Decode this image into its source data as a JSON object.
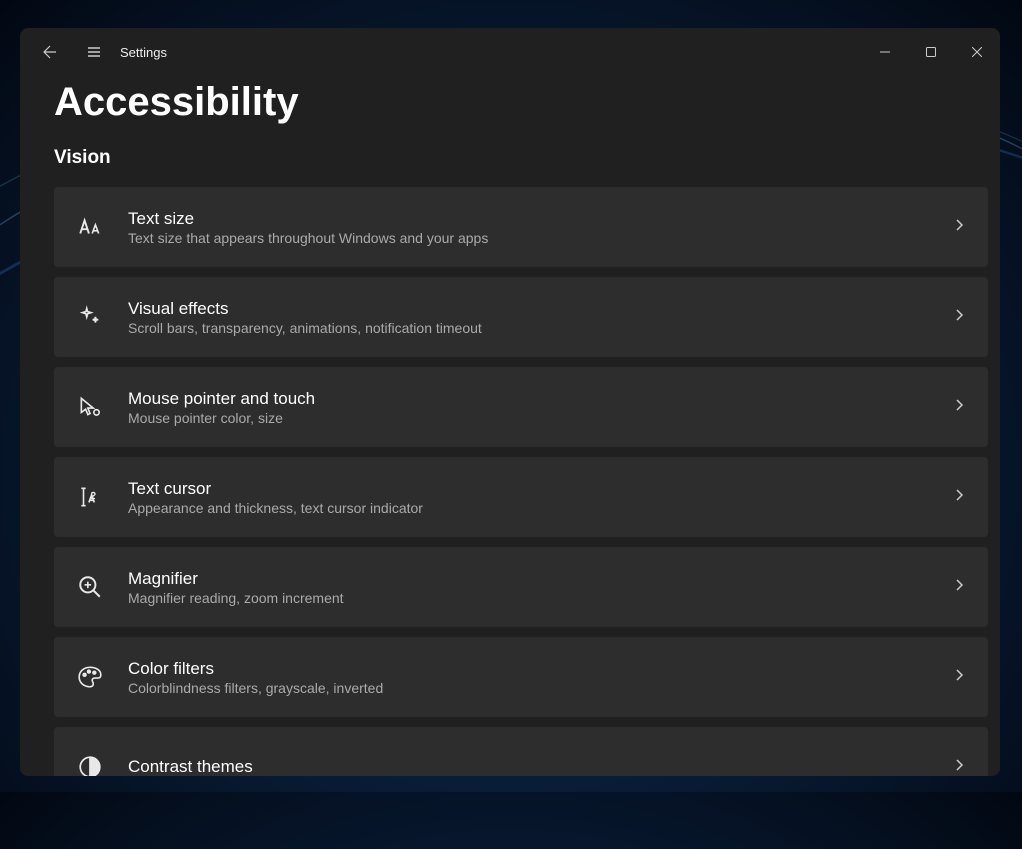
{
  "app": {
    "title": "Settings"
  },
  "page": {
    "title": "Accessibility"
  },
  "section": {
    "header": "Vision"
  },
  "items": [
    {
      "title": "Text size",
      "desc": "Text size that appears throughout Windows and your apps",
      "icon": "text-size-icon"
    },
    {
      "title": "Visual effects",
      "desc": "Scroll bars, transparency, animations, notification timeout",
      "icon": "sparkle-icon"
    },
    {
      "title": "Mouse pointer and touch",
      "desc": "Mouse pointer color, size",
      "icon": "pointer-icon"
    },
    {
      "title": "Text cursor",
      "desc": "Appearance and thickness, text cursor indicator",
      "icon": "text-cursor-icon"
    },
    {
      "title": "Magnifier",
      "desc": "Magnifier reading, zoom increment",
      "icon": "magnifier-icon"
    },
    {
      "title": "Color filters",
      "desc": "Colorblindness filters, grayscale, inverted",
      "icon": "palette-icon"
    },
    {
      "title": "Contrast themes",
      "desc": "",
      "icon": "contrast-icon"
    }
  ]
}
